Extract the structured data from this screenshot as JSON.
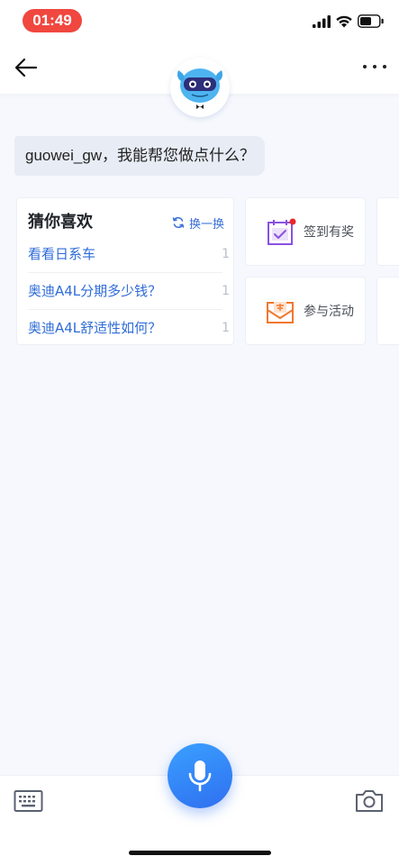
{
  "status_bar": {
    "time": "01:49",
    "accent_color": "#f0473f"
  },
  "header": {
    "back_icon": "arrow-left-icon",
    "more_icon": "more-horizontal-icon",
    "avatar_icon": "robot-mascot-icon"
  },
  "greeting": {
    "text": "guowei_gw，我能帮您做点什么？"
  },
  "guess": {
    "title": "猜你喜欢",
    "refresh_label": "换一换",
    "items": [
      {
        "label": "看看日系车",
        "num": "1"
      },
      {
        "label": "奥迪A4L分期多少钱？",
        "num": "1"
      },
      {
        "label": "奥迪A4L舒适性如何？",
        "num": "1"
      }
    ],
    "link_color": "#2f6cd8"
  },
  "actions": [
    {
      "label": "签到有奖",
      "icon": "calendar-check-icon",
      "color": "#8a52e0",
      "badge_color": "#e8262b"
    },
    {
      "label": "参与活动",
      "icon": "envelope-icon",
      "color": "#f0782f"
    }
  ],
  "bottom_bar": {
    "keyboard_icon": "keyboard-icon",
    "mic_icon": "microphone-icon",
    "camera_icon": "camera-icon",
    "mic_color": "#2f6ff0"
  }
}
